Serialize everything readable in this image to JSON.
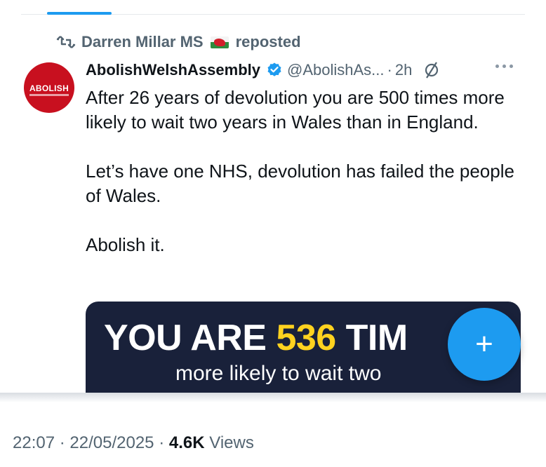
{
  "repost": {
    "reposter_name": "Darren Millar MS",
    "reposted_label": "reposted",
    "icon": "repost-icon"
  },
  "tweet": {
    "display_name": "AbolishWelshAssembly",
    "handle": "@AbolishAs...",
    "separator": "·",
    "time": "2h",
    "avatar_text": "ABOLISH",
    "paragraphs": [
      "After 26 years of devolution you are 500 times more likely to wait two years in Wales than in England.",
      "Let’s have one NHS, devolution has failed the people of Wales.",
      "Abolish it."
    ],
    "media": {
      "headline_prefix": "YOU ARE ",
      "headline_number": "536",
      "headline_suffix": " TIM",
      "subline": "more likely to wait two"
    }
  },
  "fab": {
    "label": "+"
  },
  "footer": {
    "time": "22:07",
    "sep1": "·",
    "date": "22/05/2025",
    "sep2": "·",
    "views_count": "4.6K",
    "views_label": "Views"
  },
  "colors": {
    "accent": "#1d9bf0",
    "muted_text": "#536471",
    "media_background": "#19213a",
    "highlight_yellow": "#ffd21f",
    "avatar_red": "#c8101f"
  }
}
